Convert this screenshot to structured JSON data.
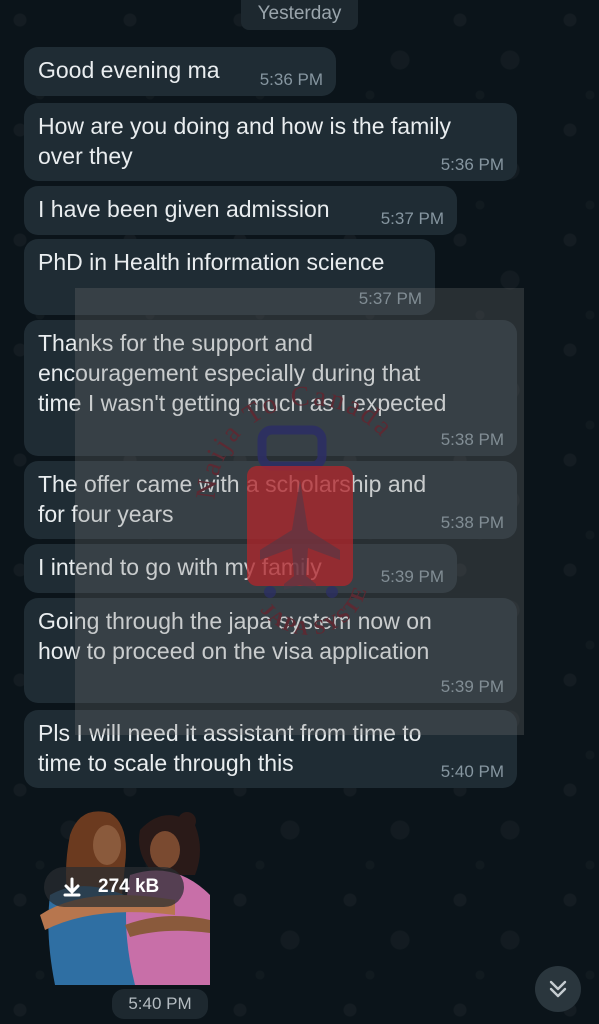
{
  "chat": {
    "date_separator": "Yesterday",
    "messages": [
      {
        "text": "Good evening ma",
        "time": "5:36 PM"
      },
      {
        "text": "How are you doing and how is the family\nover they",
        "time": "5:36 PM"
      },
      {
        "text": "I have been given admission",
        "time": "5:37 PM"
      },
      {
        "text": "PhD in Health information science",
        "time": "5:37 PM"
      },
      {
        "text": "Thanks for the support and\nencouragement especially during that\ntime I wasn't getting much as I expected",
        "time": "5:38 PM"
      },
      {
        "text": "The offer came with a scholarship and\nfor four years",
        "time": "5:38 PM"
      },
      {
        "text": "I intend to go with my family",
        "time": "5:39 PM"
      },
      {
        "text": "Going through the japa system now on\nhow to proceed on the visa application",
        "time": "5:39 PM"
      },
      {
        "text": "Pls I will need it assistant from time to\ntime to scale through this",
        "time": "5:40 PM"
      }
    ],
    "sticker": {
      "download_size": "274 kB",
      "time": "5:40 PM"
    }
  },
  "watermark": {
    "arc_text": "Naija To Canada",
    "sub_text": "JAPA SYSTEM"
  },
  "icons": {
    "download": "download-arrow-icon",
    "scroll": "double-chevron-down-icon"
  },
  "colors": {
    "background": "#0b141a",
    "bubble": "#1f2c34",
    "text": "#e9edef",
    "timestamp": "#8696a0",
    "watermark_red": "#b3262b",
    "watermark_navy": "#2c2f63"
  }
}
